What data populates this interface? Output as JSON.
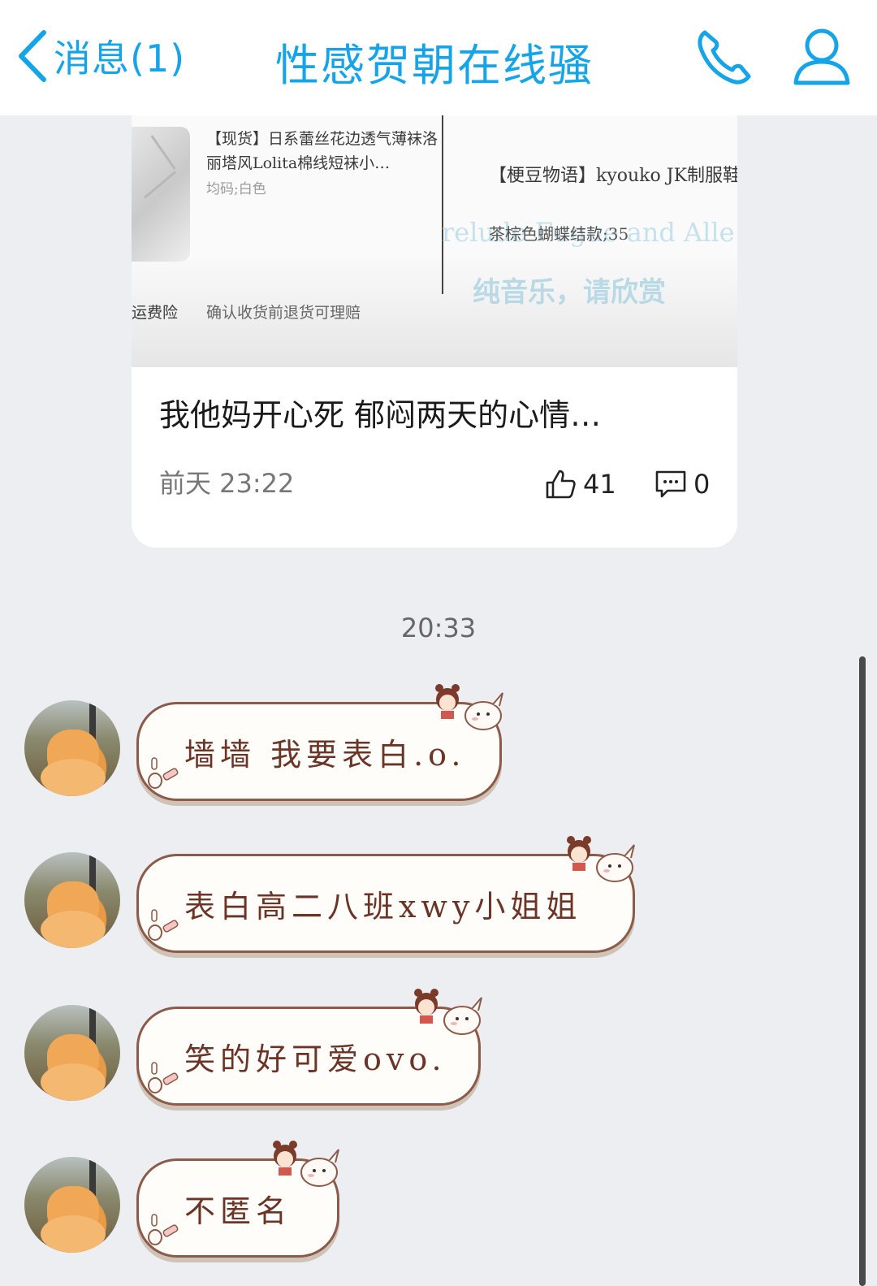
{
  "header": {
    "back_label": "消息(1)",
    "title": "性感贺朝在线骚",
    "call_icon": "phone-icon",
    "profile_icon": "person-icon",
    "accent_color": "#16a4e8"
  },
  "shared_card": {
    "screenshot": {
      "product1_title": "【现货】日系蕾丝花边透气薄袜洛丽塔风Lolita棉线短袜小…",
      "product1_spec": "均码;白色",
      "product1_insurance": "运费险",
      "product1_return": "确认收货前退货可理赔",
      "product2_title": "【梗豆物语】kyouko JK制服鞋 学院风学生正统中跟…",
      "product2_spec": "茶棕色蝴蝶结款;35",
      "watermark_line1": "relude Fugue and Alle",
      "watermark_line2": "纯音乐，请欣赏"
    },
    "post_title": "我他妈开心死 郁闷两天的心情…",
    "post_time": "前天 23:22",
    "like_count": "41",
    "comment_count": "0"
  },
  "timestamp": "20:33",
  "messages": [
    {
      "text": "墙墙 我要表白.o."
    },
    {
      "text": "表白高二八班xwy小姐姐"
    },
    {
      "text": "笑的好可爱ovo."
    },
    {
      "text": "不匿名"
    }
  ],
  "colors": {
    "background": "#eceef2",
    "bubble_border": "#8b5a48",
    "bubble_text": "#6b3426"
  }
}
